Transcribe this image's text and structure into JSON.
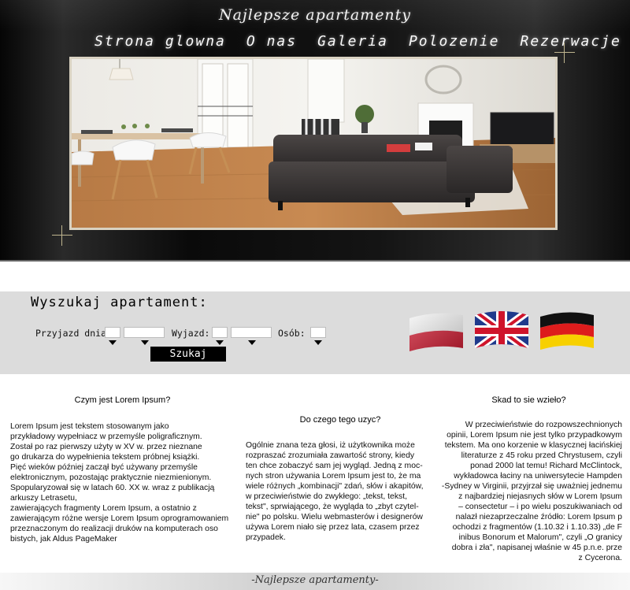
{
  "header": {
    "site_title": "Najlepsze apartamenty",
    "nav": [
      "Strona glowna",
      "O nas",
      "Galeria",
      "Polozenie",
      "Rezerwacje"
    ]
  },
  "search": {
    "title": "Wyszukaj apartament:",
    "arrival_label": "Przyjazd dnia:",
    "departure_label": "Wyjazd:",
    "persons_label": "Osób:",
    "button": "Szukaj"
  },
  "languages": [
    "polish-flag",
    "british-flag",
    "german-flag"
  ],
  "columns": [
    {
      "heading": "Czym jest Lorem Ipsum?",
      "lines": [
        "Lorem Ipsum jest tekstem stosowanym jako",
        "przykładowy wypełniacz w przemyśle poligraficznym.",
        "Został po raz pierwszy użyty w XV w. przez nieznane",
        "go drukarza do wypełnienia tekstem próbnej książki.",
        "Pięć wieków później zaczął być używany przemyśle",
        "elektronicznym, pozostając praktycznie niezmienionym.",
        "Spopularyzował się w latach 60. XX w. wraz z publikacją",
        "arkuszy Letrasetu,",
        "zawierających fragmenty Lorem Ipsum, a ostatnio z",
        "zawierającym różne wersje Lorem Ipsum oprogramowaniem",
        " przeznaczonym do realizacji druków na komputerach oso",
        "bistych, jak Aldus PageMaker"
      ]
    },
    {
      "heading": "Do czego tego uzyc?",
      "lines": [
        "Ogólnie znana teza głosi, iż użytkownika może",
        "rozpraszać zrozumiała zawartość strony, kiedy",
        "ten chce zobaczyć sam jej wygląd. Jedną z moc-",
        "nych stron używania Lorem Ipsum jest to, że ma",
        "wiele różnych „kombinacji\" zdań, słów i akapitów,",
        "w przeciwieństwie do zwykłego: „tekst, tekst,",
        "tekst\", sprwiającego, że wygląda to „zbyt czytel-",
        "nie\" po polsku. Wielu webmasterów i designerów",
        "używa Lorem niało się przez lata, czasem przez",
        "przypadek."
      ]
    },
    {
      "heading": "Skad to sie wzieło?",
      "lines": [
        "W przeciwieństwie do rozpowszechnionych",
        "opinii, Lorem Ipsum nie jest tylko przypadkowym",
        "tekstem. Ma ono korzenie w klasycznej łacińskiej",
        "literaturze z 45 roku przed Chrystusem, czyli",
        "ponad 2000 lat temu! Richard McClintock,",
        "wykładowca łaciny na uniwersytecie Hampden",
        "-Sydney w Virginii, przyjrzał się uważniej jednemu",
        "z najbardziej niejasnych słów w Lorem Ipsum",
        "– consectetur – i po wielu poszukiwaniach od",
        "nalazł niezaprzeczalne źródło: Lorem Ipsum p",
        "ochodzi z fragmentów (1.10.32 i 1.10.33) „de F",
        "inibus Bonorum et Malorum\", czyli „O granicy",
        "dobra i zła\", napisanej właśnie w 45 p.n.e. prze",
        "z Cycerona."
      ]
    }
  ],
  "footer": {
    "text": "-Najlepsze apartamenty-"
  }
}
